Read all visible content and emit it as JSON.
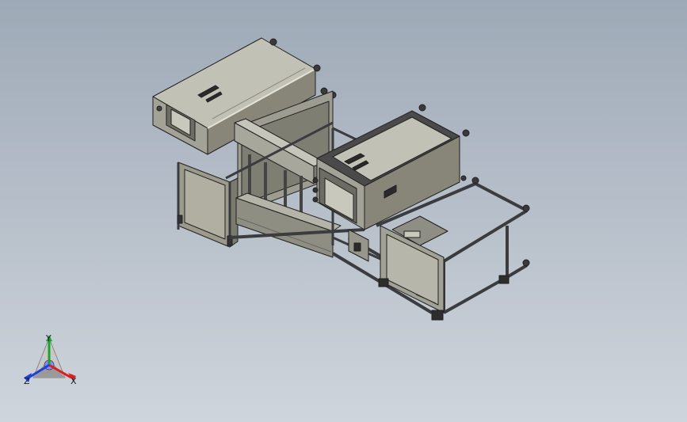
{
  "viewport": {
    "background_top": "#9ea9b7",
    "background_bottom": "#cfd5dc",
    "model_name": "",
    "model_colors": {
      "housing_top": "#c2c1b5",
      "housing_front": "#a3a296",
      "housing_side": "#878679",
      "frame": "#55575a",
      "edge": "#202020"
    }
  },
  "triad": {
    "y_label": "Y",
    "z_label": "Z",
    "x_label": "X",
    "y_color": "#1ca32c",
    "z_color": "#2040d8",
    "x_color": "#d82020"
  }
}
